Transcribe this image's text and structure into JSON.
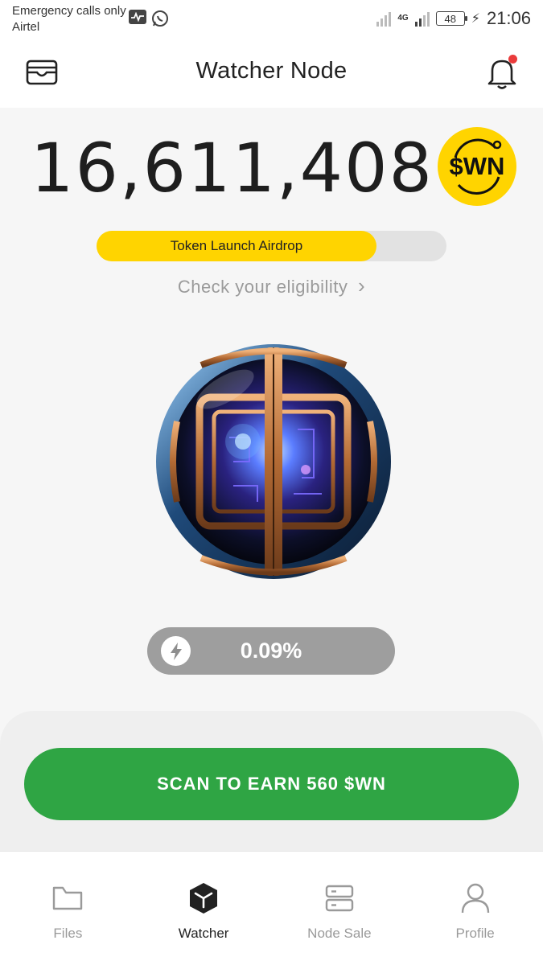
{
  "status_bar": {
    "line1": "Emergency calls only",
    "line2": "Airtel",
    "network": "4G",
    "battery": "48",
    "time": "21:06"
  },
  "header": {
    "title": "Watcher Node",
    "icons": [
      "wallet-icon",
      "bell-icon"
    ]
  },
  "balance": {
    "amount": "16,611,408",
    "token": "$WN"
  },
  "airdrop": {
    "label": "Token Launch Airdrop",
    "progress_fraction": 0.8,
    "link_text": "Check your eligibility",
    "link_chevron": "›"
  },
  "scan_status": {
    "percent": "0.09%"
  },
  "scan_button": {
    "label": "SCAN TO EARN 560 $WN"
  },
  "nav": {
    "items": [
      {
        "label": "Files",
        "icon": "folder-icon",
        "active": false
      },
      {
        "label": "Watcher",
        "icon": "cube-icon",
        "active": true
      },
      {
        "label": "Node Sale",
        "icon": "server-icon",
        "active": false
      },
      {
        "label": "Profile",
        "icon": "user-icon",
        "active": false
      }
    ]
  },
  "colors": {
    "accent_yellow": "#ffd400",
    "accent_green": "#2fa544",
    "notification_red": "#ea3b3b",
    "pill_gray": "#9e9e9e"
  }
}
